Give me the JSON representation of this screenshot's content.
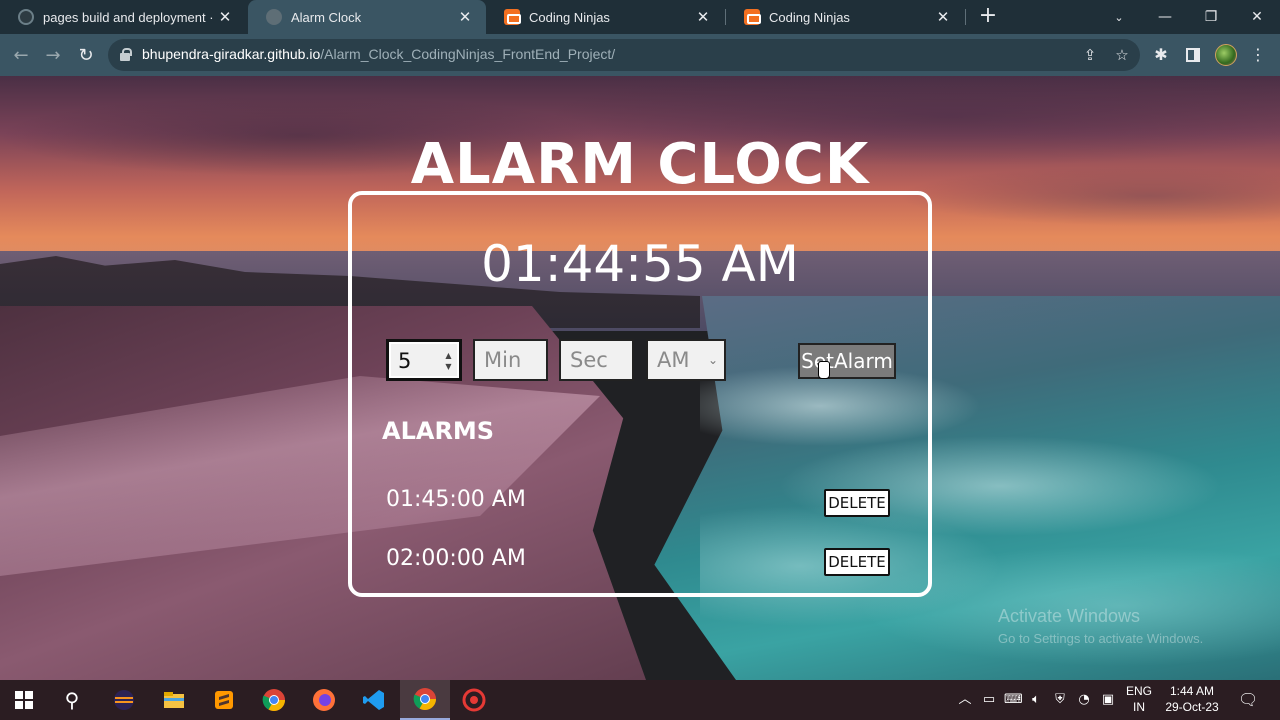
{
  "browser": {
    "tabs": [
      {
        "title": "pages build and deployment · Bl",
        "favicon": "github-icon",
        "active": false
      },
      {
        "title": "Alarm Clock",
        "favicon": "globe-icon",
        "active": true
      },
      {
        "title": "Coding Ninjas",
        "favicon": "coding-ninjas-icon",
        "active": false
      },
      {
        "title": "Coding Ninjas",
        "favicon": "coding-ninjas-icon",
        "active": false
      }
    ],
    "url_host": "bhupendra-giradkar.github.io",
    "url_path": "/Alarm_Clock_CodingNinjas_FrontEnd_Project/"
  },
  "app": {
    "title": "ALARM CLOCK",
    "current_time": "01:44:55 AM",
    "form": {
      "hour_value": "5",
      "min_placeholder": "Min",
      "sec_placeholder": "Sec",
      "ampm_value": "AM",
      "set_button": "SetAlarm"
    },
    "alarms_heading": "ALARMS",
    "alarms": [
      {
        "time": "01:45:00 AM",
        "delete_label": "DELETE"
      },
      {
        "time": "02:00:00 AM",
        "delete_label": "DELETE"
      }
    ]
  },
  "watermark": {
    "line1": "Activate Windows",
    "line2": "Go to Settings to activate Windows."
  },
  "taskbar": {
    "lang_top": "ENG",
    "lang_bottom": "IN",
    "time": "1:44 AM",
    "date": "29-Oct-23"
  },
  "colors": {
    "tab_bar": "#1f2f38",
    "toolbar": "#3a5563",
    "set_button": "#7b7b7b",
    "taskbar": "#2b1d22"
  }
}
